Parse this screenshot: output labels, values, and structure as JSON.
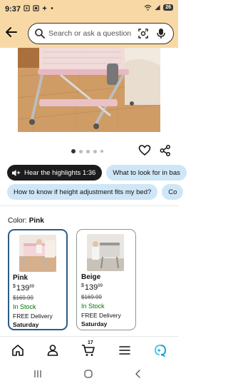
{
  "status_bar": {
    "time": "9:37",
    "icons": [
      "media-icon",
      "photos-icon",
      "gallery-icon",
      "dot"
    ],
    "battery": "26"
  },
  "header": {
    "search_placeholder": "Search or ask a question"
  },
  "gallery": {
    "image_count": 5,
    "active_index": 0
  },
  "chips_row1": [
    {
      "label": "Hear the highlights 1:36"
    },
    {
      "label": "What to look for in bas"
    }
  ],
  "chips_row2": [
    {
      "label": "How to know if height adjustment fits my bed?"
    },
    {
      "label": "Co"
    }
  ],
  "color": {
    "label": "Color:",
    "selected": "Pink"
  },
  "options": [
    {
      "name": "Pink",
      "currency": "$",
      "price_whole": "139",
      "price_fraction": "99",
      "list_price": "$169.99",
      "stock": "In Stock",
      "delivery": "FREE Delivery",
      "day": "Saturday"
    },
    {
      "name": "Beige",
      "currency": "$",
      "price_whole": "139",
      "price_fraction": "99",
      "list_price": "$169.99",
      "stock": "In Stock",
      "delivery": "FREE Delivery",
      "day": "Saturday"
    }
  ],
  "bottom_nav": {
    "cart_count": "17"
  },
  "colors": {
    "header_bg": "#f8d9a6",
    "chip_bg": "#cfe6f7",
    "in_stock": "#007600",
    "selected_border": "#2d5c85"
  }
}
